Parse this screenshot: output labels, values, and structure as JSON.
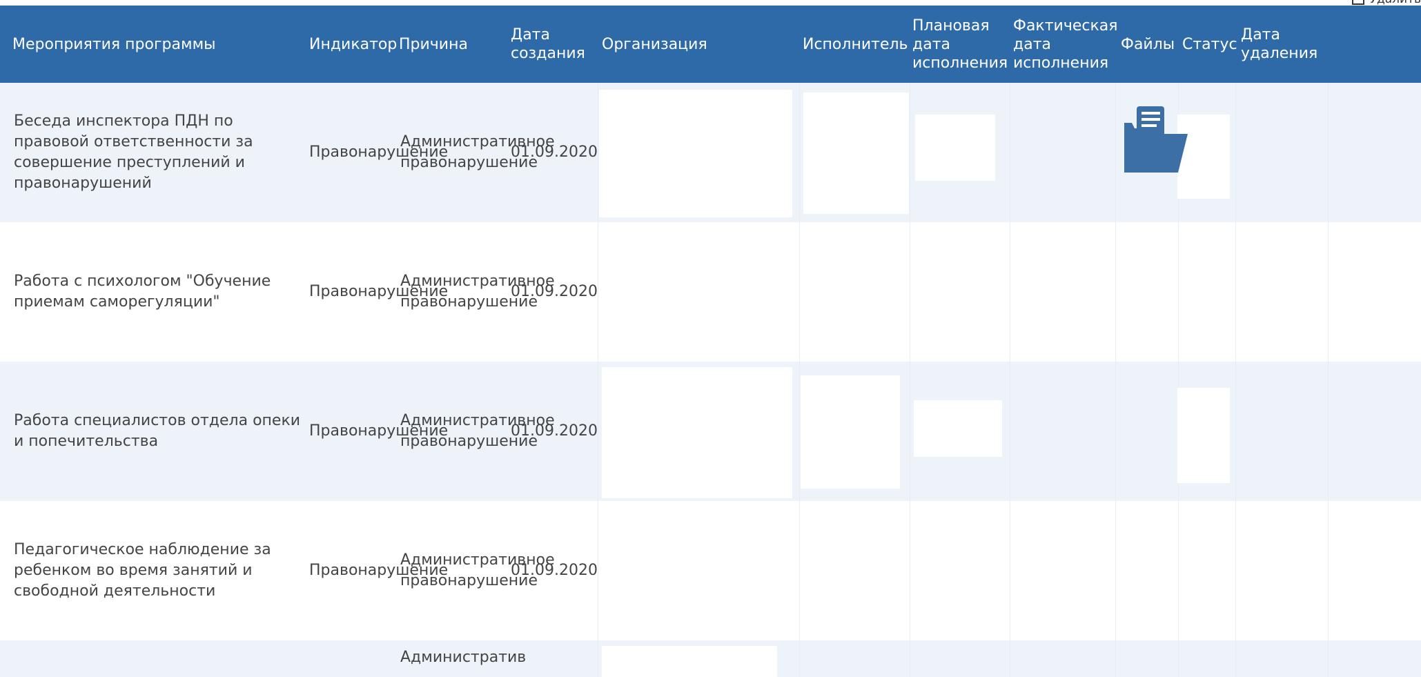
{
  "top_link": "Удалить",
  "header": {
    "program_events": "Мероприятия программы",
    "indicator": "Индикатор",
    "reason": "Причина",
    "created_date": "Дата создания",
    "organization": "Организация",
    "executor": "Исполнитель",
    "planned_date": "Плановая дата исполнения",
    "actual_date": "Фактическая дата исполнения",
    "files": "Файлы",
    "status": "Статус",
    "deleted_date": "Дата удаления"
  },
  "rows": [
    {
      "event": "Беседа инспектора ПДН по правовой ответственности за совершение преступлений и правонарушений",
      "indicator": "Правонарушение",
      "reason": "Административное правонарушение",
      "created": "01.09.2020"
    },
    {
      "event": "Работа с психологом \"Обучение приемам саморегуляции\"",
      "indicator": "Правонарушение",
      "reason": "Административное правонарушение",
      "created": "01.09.2020"
    },
    {
      "event": "Работа специалистов отдела опеки и попечительства",
      "indicator": "Правонарушение",
      "reason": "Административное правонарушение",
      "created": "01.09.2020"
    },
    {
      "event": "Педагогическое наблюдение за ребенком во время занятий и свободной деятельности",
      "indicator": "Правонарушение",
      "reason": "Административное правонарушение",
      "created": "01.09.2020"
    },
    {
      "reason": "Административ"
    }
  ],
  "icons": {
    "files_icon": "folder-document-icon"
  },
  "colors": {
    "header_bg": "#2f6aa8",
    "row_shaded": "#eef3fa"
  }
}
